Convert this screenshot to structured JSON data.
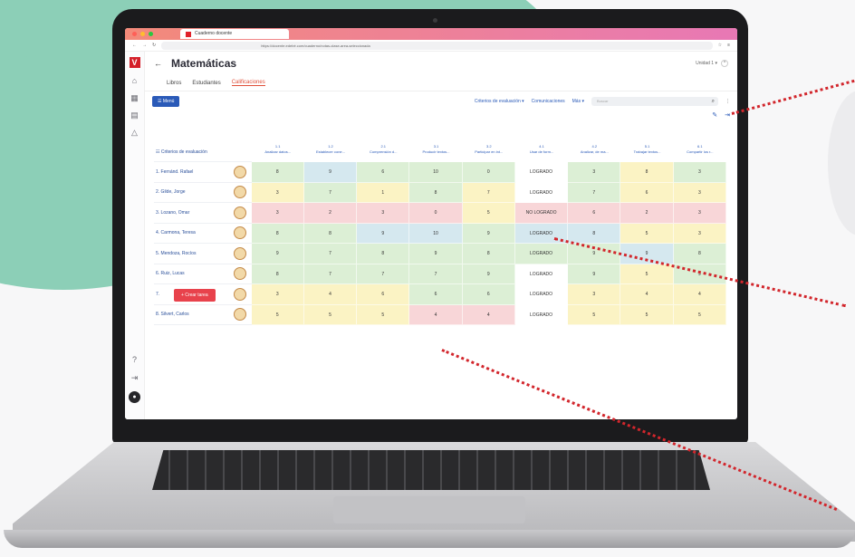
{
  "browser": {
    "tab_title": "Cuaderno docente",
    "url": "https://docente.edebé.com/cuaderno/notas-clase-area-seleccionada"
  },
  "header": {
    "title": "Matemáticas",
    "course": "Unidad 1 ▾"
  },
  "tabs": [
    "Libros",
    "Estudiantes",
    "Calificaciones"
  ],
  "toolbar": {
    "menu_label": "☰ Menú",
    "criteria_link": "Criterios de evaluación ▾",
    "comm_link": "Comunicaciones",
    "more_link": "Más ▾",
    "search_placeholder": "Buscar"
  },
  "grid": {
    "student_header": "☷ Criterios de evaluación",
    "columns": [
      {
        "code": "1.1",
        "label": "Analizar datos..."
      },
      {
        "code": "1.2",
        "label": "Establecer cone..."
      },
      {
        "code": "2.1",
        "label": "Comprensión d..."
      },
      {
        "code": "3.1",
        "label": "Producir textos..."
      },
      {
        "code": "3.2",
        "label": "Participar en int..."
      },
      {
        "code": "4.1",
        "label": "Usar de form..."
      },
      {
        "code": "4.2",
        "label": "Analizar, de ma..."
      },
      {
        "code": "5.1",
        "label": "Trabajar textos..."
      },
      {
        "code": "6.1",
        "label": "Compartir los r..."
      }
    ],
    "rows": [
      {
        "name": "1. Fernánd. Rafael",
        "cells": [
          "8",
          "9",
          "6",
          "10",
          "0",
          "LOGRADO",
          "3",
          "8",
          "3"
        ],
        "colors": [
          "green",
          "blue",
          "green",
          "green",
          "green",
          "white",
          "green",
          "yellow",
          "green"
        ]
      },
      {
        "name": "2. Gilde, Jorge",
        "cells": [
          "3",
          "7",
          "1",
          "8",
          "7",
          "LOGRADO",
          "7",
          "6",
          "3"
        ],
        "colors": [
          "yellow",
          "green",
          "yellow",
          "green",
          "yellow",
          "white",
          "green",
          "yellow",
          "yellow"
        ]
      },
      {
        "name": "3. Lozano, Omar",
        "cells": [
          "3",
          "2",
          "3",
          "0",
          "5",
          "NO LOGRADO",
          "6",
          "2",
          "3"
        ],
        "colors": [
          "pink",
          "pink",
          "pink",
          "pink",
          "yellow",
          "pink",
          "pink",
          "pink",
          "pink"
        ]
      },
      {
        "name": "4. Carmona, Teresa",
        "cells": [
          "8",
          "8",
          "9",
          "10",
          "9",
          "LOGRADO",
          "8",
          "5",
          "3"
        ],
        "colors": [
          "green",
          "green",
          "blue",
          "blue",
          "green",
          "blue",
          "blue",
          "yellow",
          "yellow"
        ]
      },
      {
        "name": "5. Mendoza, Rocíos",
        "cells": [
          "9",
          "7",
          "8",
          "9",
          "8",
          "LOGRADO",
          "9",
          "9",
          "8"
        ],
        "colors": [
          "green",
          "green",
          "green",
          "green",
          "green",
          "green",
          "green",
          "blue",
          "green"
        ]
      },
      {
        "name": "6. Ruiz, Lucas",
        "cells": [
          "8",
          "7",
          "7",
          "7",
          "9",
          "LOGRADO",
          "9",
          "5",
          "9"
        ],
        "colors": [
          "green",
          "green",
          "green",
          "green",
          "green",
          "white",
          "green",
          "yellow",
          "green"
        ]
      },
      {
        "name": "7.",
        "cells": [
          "3",
          "4",
          "6",
          "6",
          "6",
          "LOGRADO",
          "3",
          "4",
          "4"
        ],
        "colors": [
          "yellow",
          "yellow",
          "yellow",
          "green",
          "green",
          "white",
          "yellow",
          "yellow",
          "yellow"
        ]
      },
      {
        "name": "8. Silvert, Carlos",
        "cells": [
          "5",
          "5",
          "5",
          "4",
          "4",
          "LOGRADO",
          "5",
          "5",
          "5"
        ],
        "colors": [
          "yellow",
          "yellow",
          "yellow",
          "pink",
          "pink",
          "white",
          "yellow",
          "yellow",
          "yellow"
        ]
      }
    ]
  },
  "fab_label": "+ Crear tarea",
  "colors": {
    "brand": "#d4202a",
    "accent": "#e0503a",
    "link": "#2a5ab8",
    "background_blob": "#8ccfb7"
  }
}
